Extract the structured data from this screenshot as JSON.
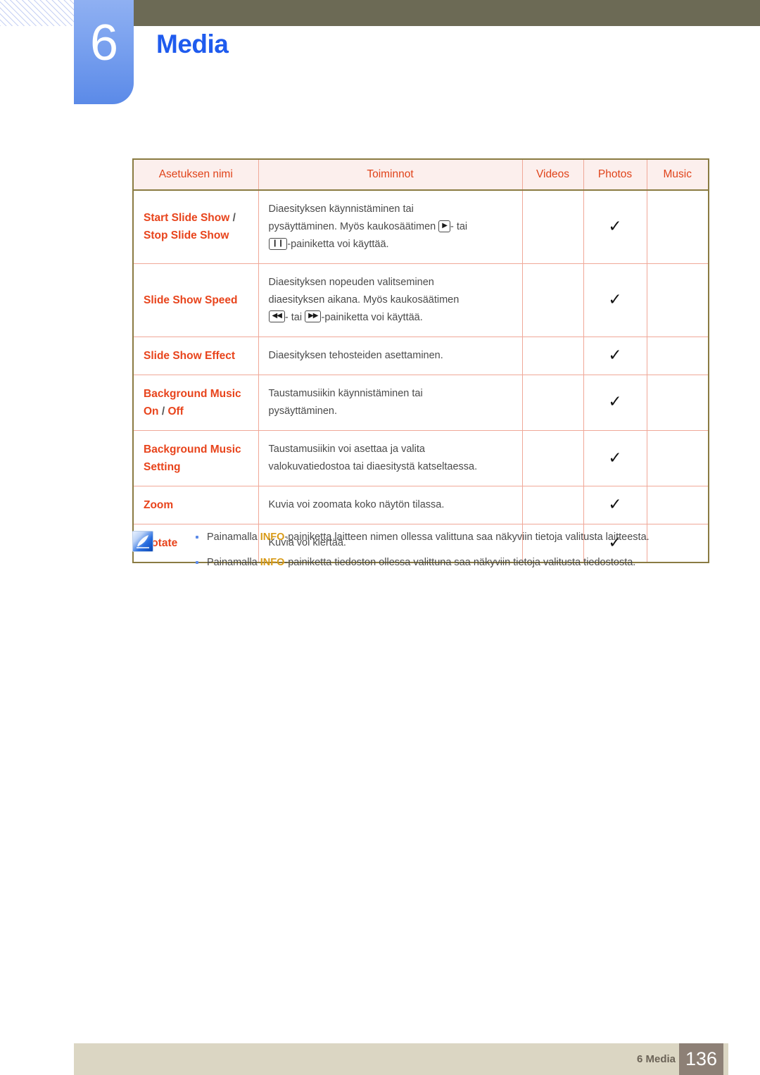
{
  "header": {
    "chapter_number": "6",
    "chapter_title": "Media",
    "accent_blue": "#1f5bee",
    "badge_blue": "#7ba2ef",
    "bar_olive": "#6c6a55"
  },
  "table": {
    "columns": [
      "Asetuksen nimi",
      "Toiminnot",
      "Videos",
      "Photos",
      "Music"
    ],
    "header_bg": "#fcefed",
    "header_text_color": "#e0431a",
    "border_outer_color": "#8a7b42",
    "border_inner_color": "#f0a898",
    "rows": [
      {
        "name_parts": [
          {
            "text": "Start Slide Show",
            "style": "name"
          },
          {
            "text": " / ",
            "style": "sep"
          },
          {
            "text": "Stop Slide Show",
            "style": "name"
          }
        ],
        "name_plain": "Start Slide Show / Stop Slide Show",
        "function_lines": [
          {
            "text": "Diaesityksen käynnistäminen tai"
          },
          {
            "text": "pysäyttäminen. Myös kaukosäätimen ",
            "key": "play",
            "after": "- tai"
          },
          {
            "key_first": "pause",
            "text": "-painiketta voi käyttää."
          }
        ],
        "videos": "",
        "photos": "✓",
        "music": ""
      },
      {
        "name_parts": [
          {
            "text": "Slide Show Speed",
            "style": "name"
          }
        ],
        "name_plain": "Slide Show Speed",
        "function_lines": [
          {
            "text": "Diaesityksen nopeuden valitseminen"
          },
          {
            "text": "diaesityksen aikana. Myös kaukosäätimen"
          },
          {
            "key_first": "rew",
            "text": "- tai ",
            "key": "ff",
            "after": "-painiketta voi käyttää."
          }
        ],
        "videos": "",
        "photos": "✓",
        "music": ""
      },
      {
        "name_parts": [
          {
            "text": "Slide Show Effect",
            "style": "name"
          }
        ],
        "name_plain": "Slide Show Effect",
        "function_lines": [
          {
            "text": "Diaesityksen tehosteiden asettaminen."
          }
        ],
        "videos": "",
        "photos": "✓",
        "music": ""
      },
      {
        "name_parts": [
          {
            "text": "Background Music On",
            "style": "name"
          },
          {
            "text": " / ",
            "style": "sep"
          },
          {
            "text": "Off",
            "style": "name"
          }
        ],
        "name_plain": "Background Music On / Off",
        "function_lines": [
          {
            "text": "Taustamusiikin käynnistäminen tai"
          },
          {
            "text": "pysäyttäminen."
          }
        ],
        "videos": "",
        "photos": "✓",
        "music": ""
      },
      {
        "name_parts": [
          {
            "text": "Background Music Setting",
            "style": "name"
          }
        ],
        "name_plain": "Background Music Setting",
        "function_lines": [
          {
            "text": "Taustamusiikin voi asettaa ja valita"
          },
          {
            "text": "valokuvatiedostoa tai diaesitystä katseltaessa."
          }
        ],
        "videos": "",
        "photos": "✓",
        "music": ""
      },
      {
        "name_parts": [
          {
            "text": "Zoom",
            "style": "name"
          }
        ],
        "name_plain": "Zoom",
        "function_lines": [
          {
            "text": "Kuvia voi zoomata koko näytön tilassa."
          }
        ],
        "videos": "",
        "photos": "✓",
        "music": ""
      },
      {
        "name_parts": [
          {
            "text": "Rotate",
            "style": "name"
          }
        ],
        "name_plain": "Rotate",
        "function_lines": [
          {
            "text": "Kuvia voi kiertää."
          }
        ],
        "videos": "",
        "photos": "✓",
        "music": ""
      }
    ]
  },
  "notes": {
    "icon": "note-quill-icon",
    "items": [
      {
        "before": "Painamalla ",
        "emphasis": "INFO",
        "after": "-painiketta laitteen nimen ollessa valittuna saa näkyviin tietoja valitusta laitteesta."
      },
      {
        "before": "Painamalla ",
        "emphasis": "INFO",
        "after": "-painiketta tiedoston ollessa valittuna saa näkyviin tietoja valitusta tiedostosta."
      }
    ]
  },
  "footer": {
    "label": "6 Media",
    "page_number": "136",
    "bar_color": "#dbd6c3",
    "page_box_color": "#8d8076"
  }
}
